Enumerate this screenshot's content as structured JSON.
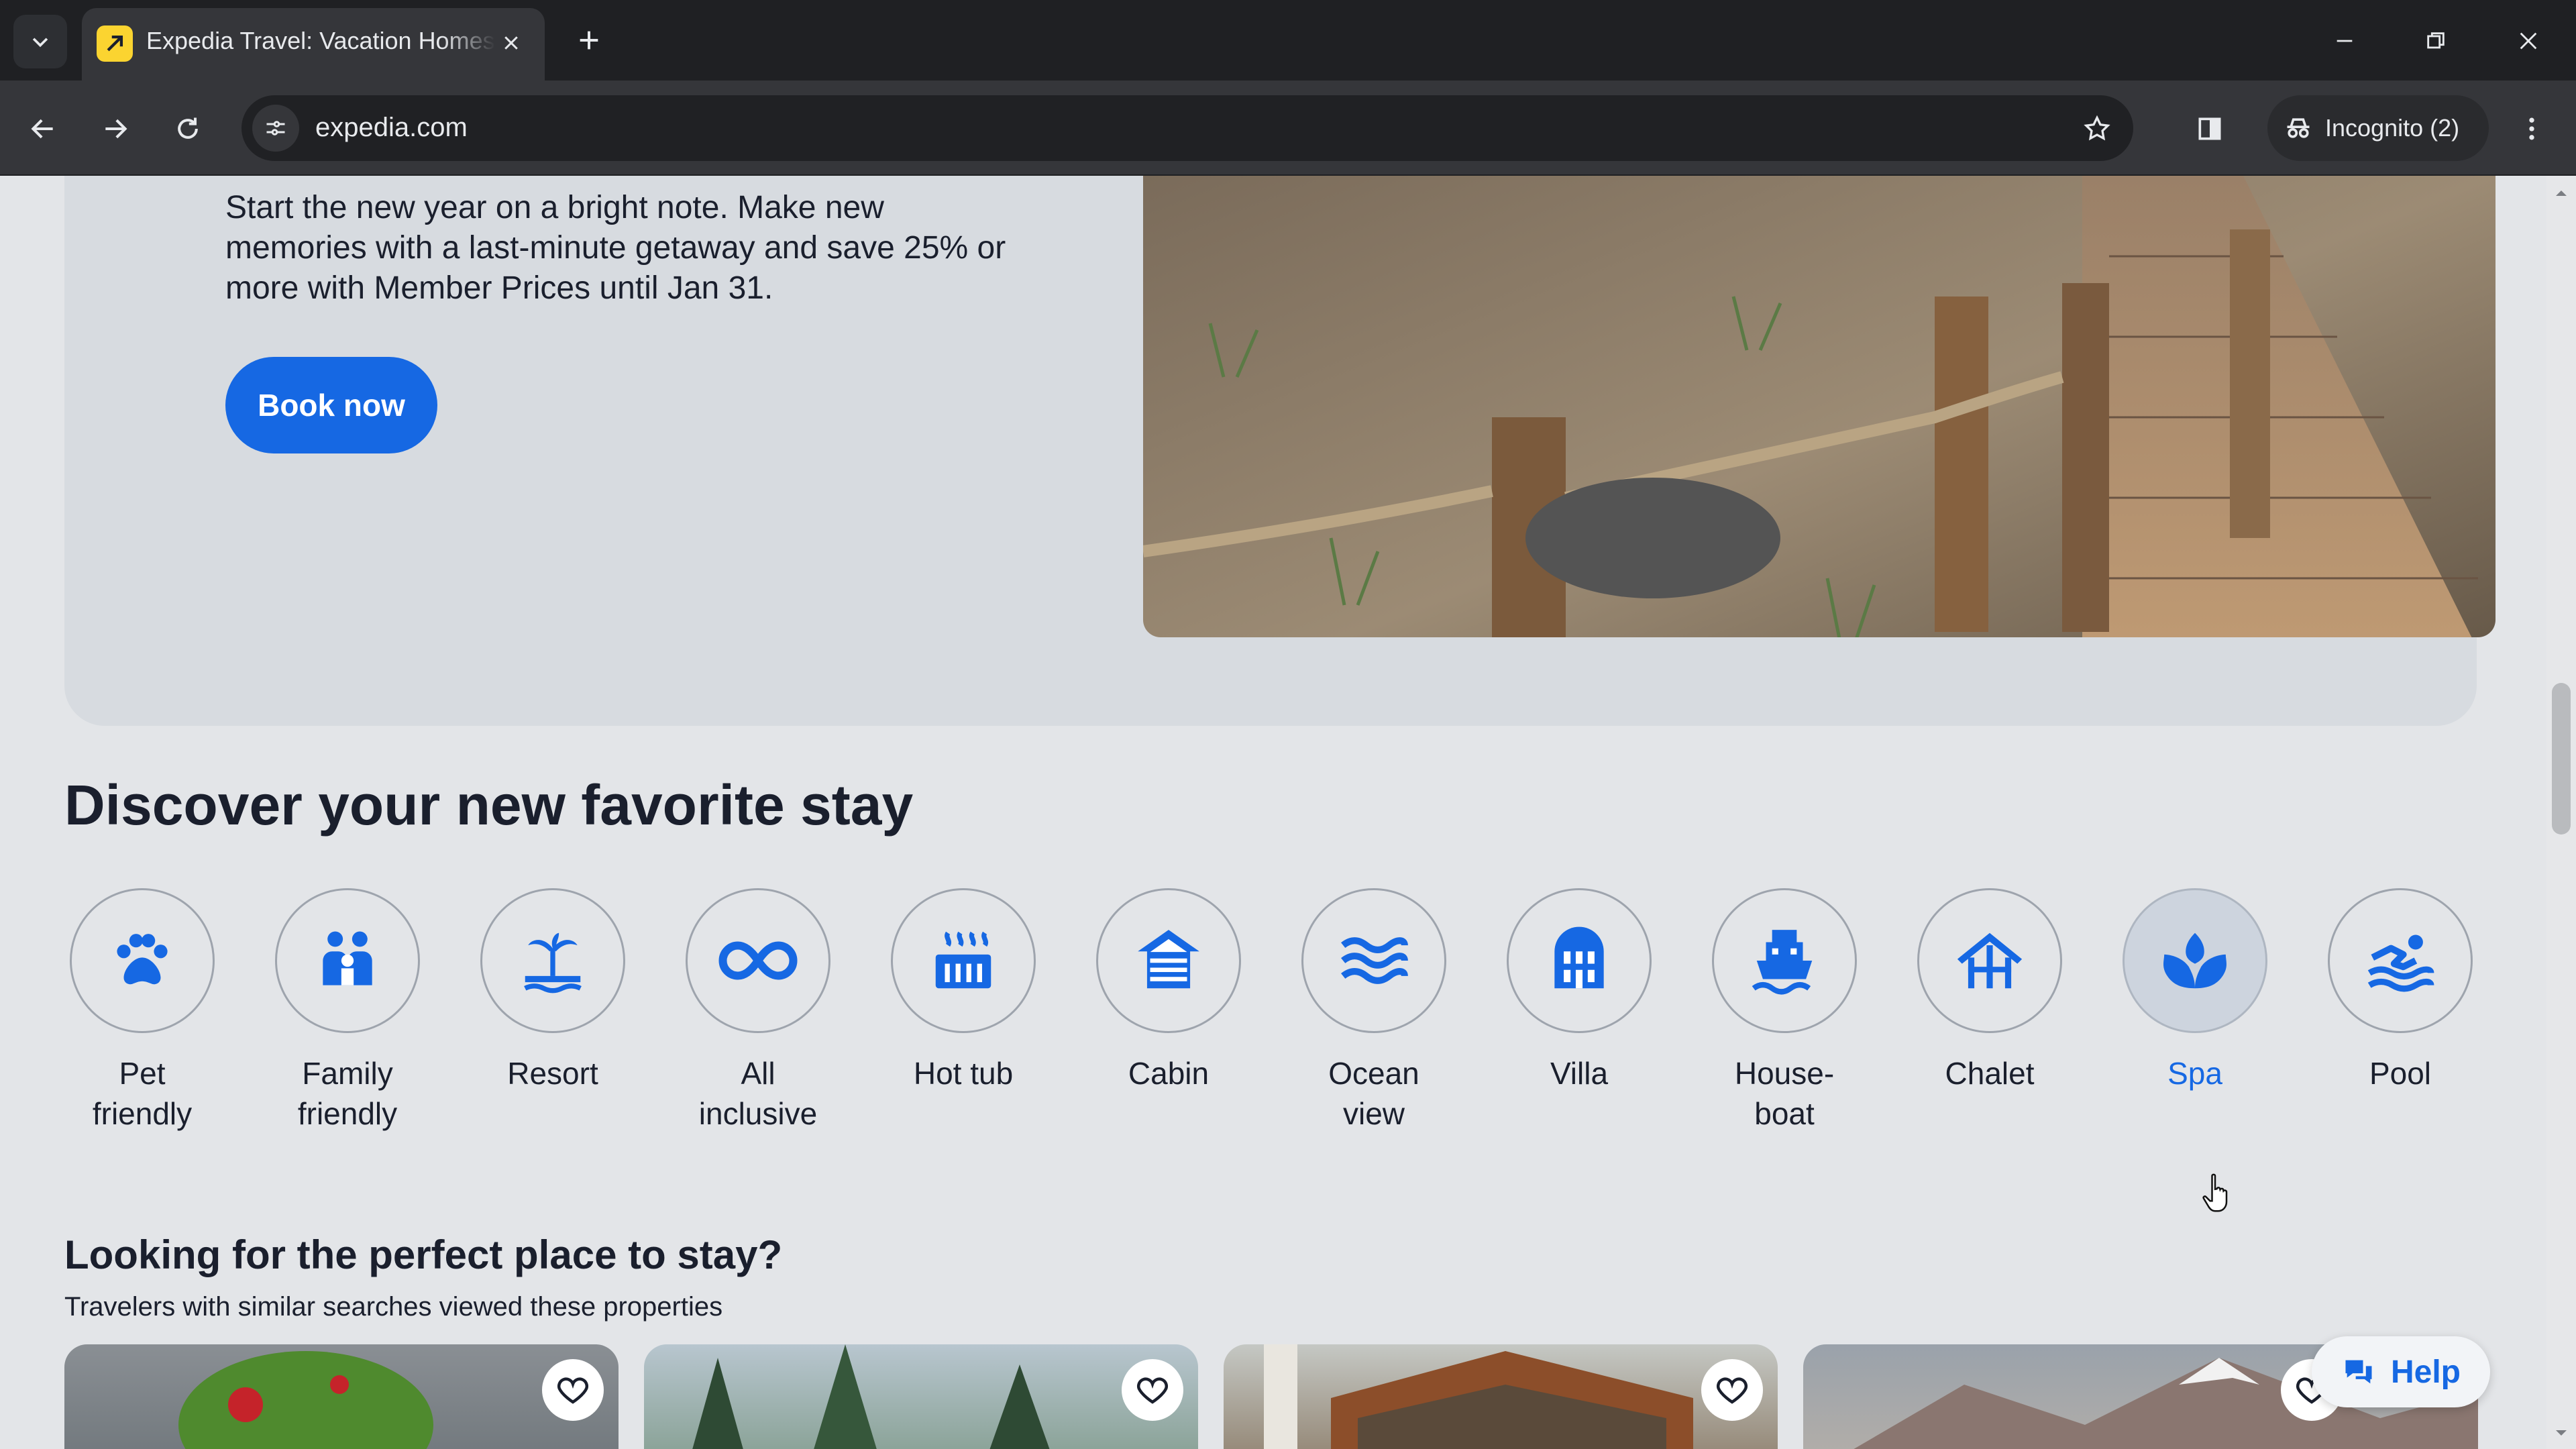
{
  "browser": {
    "tab_title": "Expedia Travel: Vacation Homes, Hotels & Flights",
    "url": "expedia.com",
    "incognito_label": "Incognito (2)"
  },
  "promo": {
    "text": "Start the new year on a bright note. Make new memories with a last-minute getaway and save 25% or more with Member Prices until Jan 31.",
    "book_label": "Book now"
  },
  "discover": {
    "title": "Discover your new favorite stay",
    "categories": [
      {
        "label": "Pet\nfriendly",
        "icon": "paw-icon"
      },
      {
        "label": "Family\nfriendly",
        "icon": "family-icon"
      },
      {
        "label": "Resort",
        "icon": "palm-island-icon"
      },
      {
        "label": "All\ninclusive",
        "icon": "infinity-icon"
      },
      {
        "label": "Hot tub",
        "icon": "hot-tub-icon"
      },
      {
        "label": "Cabin",
        "icon": "cabin-icon"
      },
      {
        "label": "Ocean\nview",
        "icon": "waves-icon"
      },
      {
        "label": "Villa",
        "icon": "villa-icon"
      },
      {
        "label": "House-\nboat",
        "icon": "houseboat-icon"
      },
      {
        "label": "Chalet",
        "icon": "chalet-icon"
      },
      {
        "label": "Spa",
        "icon": "spa-lotus-icon",
        "selected": true
      },
      {
        "label": "Pool",
        "icon": "swimmer-icon"
      }
    ]
  },
  "looking": {
    "title": "Looking for the perfect place to stay?",
    "subtitle": "Travelers with similar searches viewed these properties"
  },
  "help_label": "Help",
  "colors": {
    "accent": "#1668e3",
    "page_bg": "#e3e5e8",
    "card_bg": "#d7dbe0",
    "text": "#1a1f2d"
  }
}
